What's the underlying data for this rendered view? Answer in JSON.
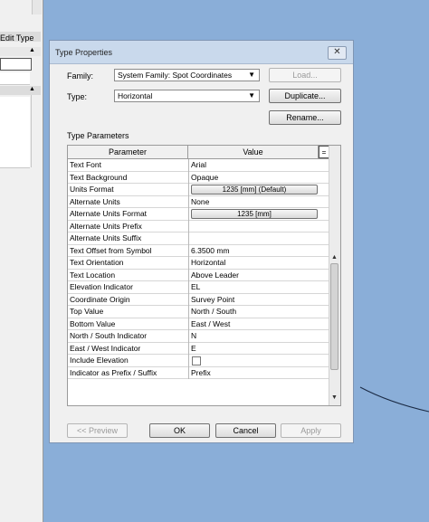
{
  "left_panel": {
    "edit_type_label": "Edit Type"
  },
  "dialog": {
    "title": "Type Properties",
    "close_glyph": "✕",
    "family_label": "Family:",
    "family_value": "System Family: Spot Coordinates",
    "type_label": "Type:",
    "type_value": "Horizontal",
    "load_button": "Load...",
    "duplicate_button": "Duplicate...",
    "rename_button": "Rename...",
    "type_parameters_label": "Type Parameters",
    "columns": {
      "parameter": "Parameter",
      "value": "Value",
      "eq": "="
    },
    "rows": [
      {
        "param": "Text Font",
        "value": "Arial",
        "kind": "text"
      },
      {
        "param": "Text Background",
        "value": "Opaque",
        "kind": "text"
      },
      {
        "param": "Units Format",
        "value": "1235 [mm] (Default)",
        "kind": "button"
      },
      {
        "param": "Alternate Units",
        "value": "None",
        "kind": "text"
      },
      {
        "param": "Alternate Units Format",
        "value": "1235 [mm]",
        "kind": "button"
      },
      {
        "param": "Alternate Units Prefix",
        "value": "",
        "kind": "text"
      },
      {
        "param": "Alternate Units Suffix",
        "value": "",
        "kind": "text"
      },
      {
        "param": "Text Offset from Symbol",
        "value": "6.3500 mm",
        "kind": "text"
      },
      {
        "param": "Text Orientation",
        "value": "Horizontal",
        "kind": "text"
      },
      {
        "param": "Text Location",
        "value": "Above Leader",
        "kind": "text"
      },
      {
        "param": "Elevation Indicator",
        "value": "EL",
        "kind": "text"
      },
      {
        "param": "Coordinate Origin",
        "value": "Survey Point",
        "kind": "text"
      },
      {
        "param": "Top Value",
        "value": "North / South",
        "kind": "text"
      },
      {
        "param": "Bottom Value",
        "value": "East / West",
        "kind": "text"
      },
      {
        "param": "North / South Indicator",
        "value": "N",
        "kind": "text"
      },
      {
        "param": "East / West Indicator",
        "value": "E",
        "kind": "text"
      },
      {
        "param": "Include Elevation",
        "value": "",
        "kind": "checkbox"
      },
      {
        "param": "Indicator as Prefix / Suffix",
        "value": "Prefix",
        "kind": "text"
      }
    ],
    "preview_button": "<< Preview",
    "ok_button": "OK",
    "cancel_button": "Cancel",
    "apply_button": "Apply"
  },
  "colors": {
    "background": "#8aaed8",
    "dialog_face": "#f0f0f0",
    "titlebar": "#c9d9ec"
  }
}
